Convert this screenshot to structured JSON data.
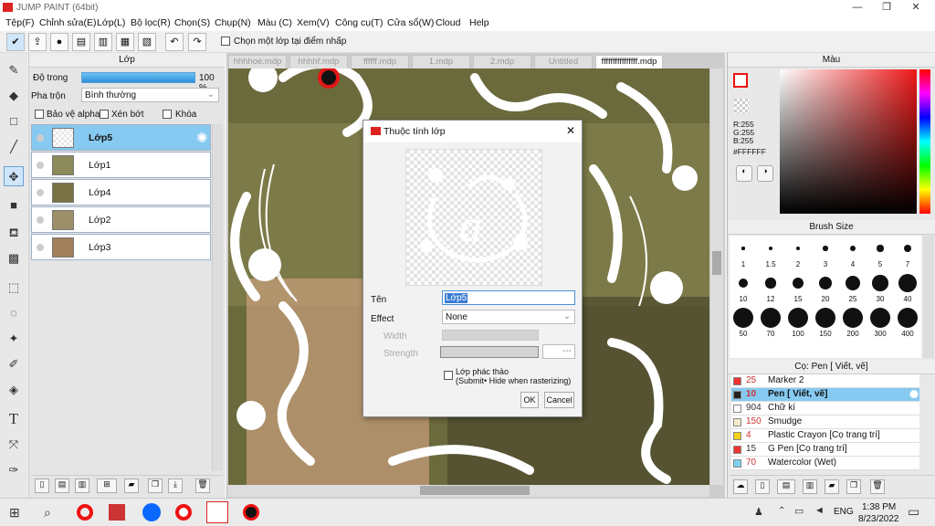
{
  "window": {
    "title": "JUMP PAINT (64bit)",
    "min": "—",
    "max": "❐",
    "close": "✕"
  },
  "menu": [
    "Tệp(F)",
    "Chỉnh sửa(E)",
    "Lớp(L)",
    "Bộ lọc(R)",
    "Chọn(S)",
    "Chụp(N)",
    "Màu (C)",
    "Xem(V)",
    "Công cụ(T)",
    "Cửa sổ(W)",
    "Cloud",
    "Help"
  ],
  "toolbar": {
    "checkbox_label": "Chọn một lớp tại điểm nhấp"
  },
  "layer_panel": {
    "title": "Lớp",
    "opacity_label": "Độ trong",
    "opacity_value": "100 %",
    "opacity": 1.0,
    "blend_label": "Pha trộn",
    "blend_value": "Bình thường",
    "protect_alpha": "Bảo vệ alpha",
    "clip": "Xén bớt",
    "lock": "Khóa",
    "layers": [
      {
        "name": "Lớp5",
        "selected": true
      },
      {
        "name": "Lớp1"
      },
      {
        "name": "Lớp4"
      },
      {
        "name": "Lớp2"
      },
      {
        "name": "Lớp3"
      }
    ]
  },
  "tabs": [
    "hhhhoe.mdp",
    "hhhhf.mdp",
    "ffffff.mdp",
    "1.mdp",
    "2.mdp",
    "Untitled",
    "ffffffffffffffff.mdp"
  ],
  "dialog": {
    "title": "Thuộc tính lớp",
    "name_label": "Tên",
    "name_value": "Lớp5",
    "effect_label": "Effect",
    "effect_value": "None",
    "width_label": "Width",
    "strength_label": "Strength",
    "strength_value": "---",
    "sketch_label": "Lớp phác thảo",
    "sketch_note": "(Submit• Hide when rasterizing)",
    "ok": "OK",
    "cancel": "Cancel"
  },
  "color_panel": {
    "title": "Màu",
    "r": "R:255",
    "g": "G:255",
    "b": "B:255",
    "hex": "#FFFFFF"
  },
  "brush_size_panel": {
    "title": "Brush Size",
    "sizes": [
      "1",
      "1.5",
      "2",
      "3",
      "4",
      "5",
      "7",
      "10",
      "12",
      "15",
      "20",
      "25",
      "30",
      "40",
      "50",
      "70",
      "100",
      "150",
      "200",
      "300",
      "400"
    ]
  },
  "brush_panel": {
    "title": "Cọ: Pen [ Viết, vẽ]",
    "items": [
      {
        "size": "25",
        "name": "Marker 2",
        "color": "#e33"
      },
      {
        "size": "10",
        "name": "Pen [ Viết, vẽ]",
        "color": "#222",
        "selected": true
      },
      {
        "size": "904",
        "name": "Chữ kí",
        "color": "#fff"
      },
      {
        "size": "150",
        "name": "Smudge",
        "color": "#f5e9c8"
      },
      {
        "size": "4",
        "name": "Plastic Crayon [Cọ trang trí]",
        "color": "#f2d21c"
      },
      {
        "size": "15",
        "name": "G Pen [Cọ trang trí]",
        "color": "#e33"
      },
      {
        "size": "70",
        "name": "Watercolor (Wet)",
        "color": "#7cd2f0"
      }
    ]
  },
  "taskbar": {
    "time": "1:38 PM",
    "date": "8/23/2022",
    "lang": "ENG"
  }
}
